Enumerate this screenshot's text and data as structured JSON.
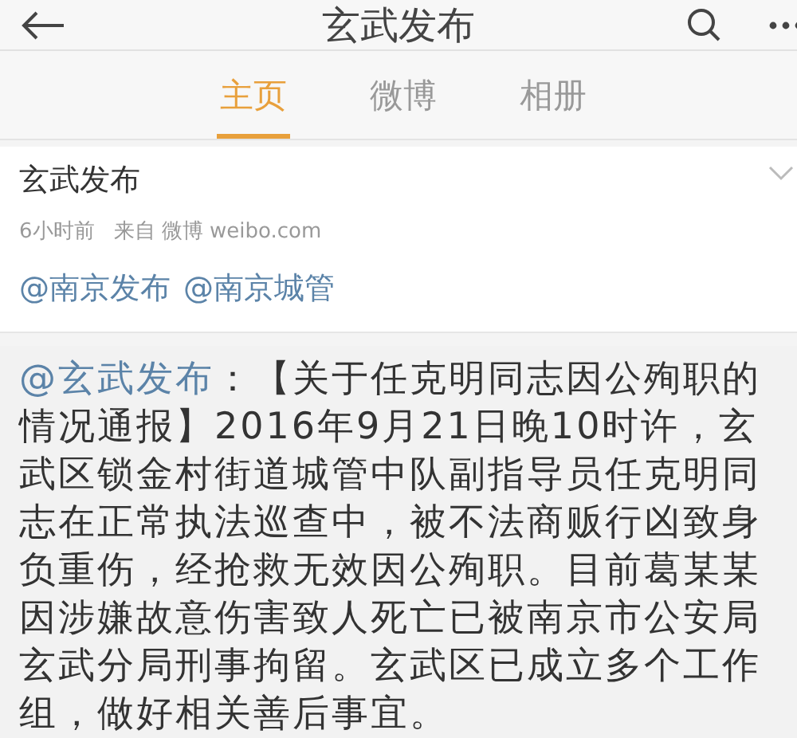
{
  "header": {
    "title": "玄武发布"
  },
  "tabs": [
    {
      "label": "主页",
      "selected": true
    },
    {
      "label": "微博",
      "selected": false
    },
    {
      "label": "相册",
      "selected": false
    }
  ],
  "post": {
    "author": "玄武发布",
    "time": "6小时前",
    "source": "来自 微博 weibo.com",
    "mentions": [
      "@南京发布",
      "@南京城管"
    ]
  },
  "repost": {
    "author_link": "@玄武发布",
    "text": "：【关于任克明同志因公殉职的情况通报】2016年9月21日晚10时许，玄武区锁金村街道城管中队副指导员任克明同志在正常执法巡查中，被不法商贩行凶致身负重伤，经抢救无效因公殉职。目前葛某某因涉嫌故意伤害致人死亡已被南京市公安局玄武分局刑事拘留。玄武区已成立多个工作组，做好相关善后事宜。"
  }
}
